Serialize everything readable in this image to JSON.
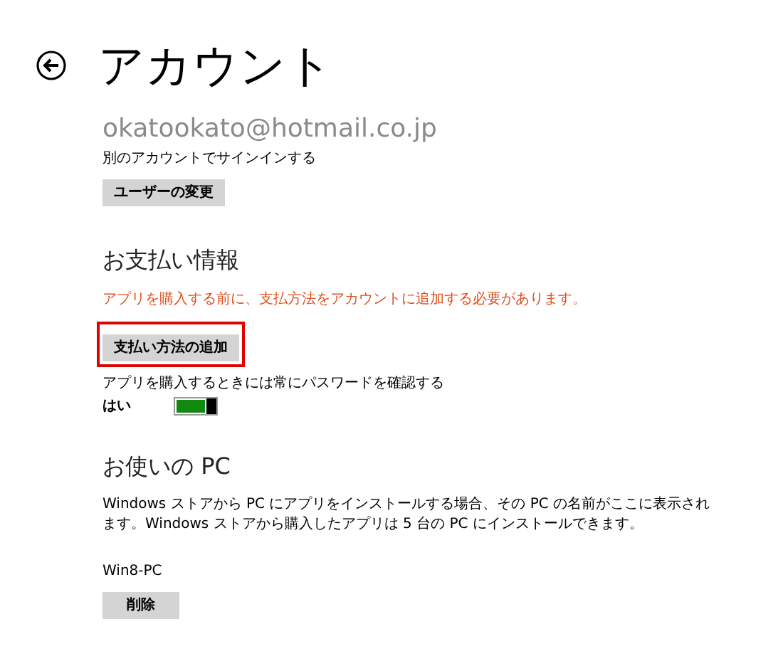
{
  "page": {
    "title": "アカウント"
  },
  "account": {
    "email": "okatookato@hotmail.co.jp",
    "hint": "別のアカウントでサインインする",
    "button": "ユーザーの変更"
  },
  "payment": {
    "heading": "お支払い情報",
    "warning": "アプリを購入する前に、支払方法をアカウントに追加する必要があります。",
    "button": {
      "label": "支払い方法の追加",
      "highlighted": true
    },
    "password_label": "アプリを購入するときには常にパスワードを確認する",
    "toggle": {
      "label": "はい",
      "on": true
    }
  },
  "pcs": {
    "heading": "お使いの PC",
    "description": "Windows ストアから PC にアプリをインストールする場合、その PC の名前がここに表示されます。Windows ストアから購入したアプリは 5 台の PC にインストールできます。",
    "items": [
      {
        "name": "Win8-PC",
        "button": "削除"
      }
    ]
  }
}
